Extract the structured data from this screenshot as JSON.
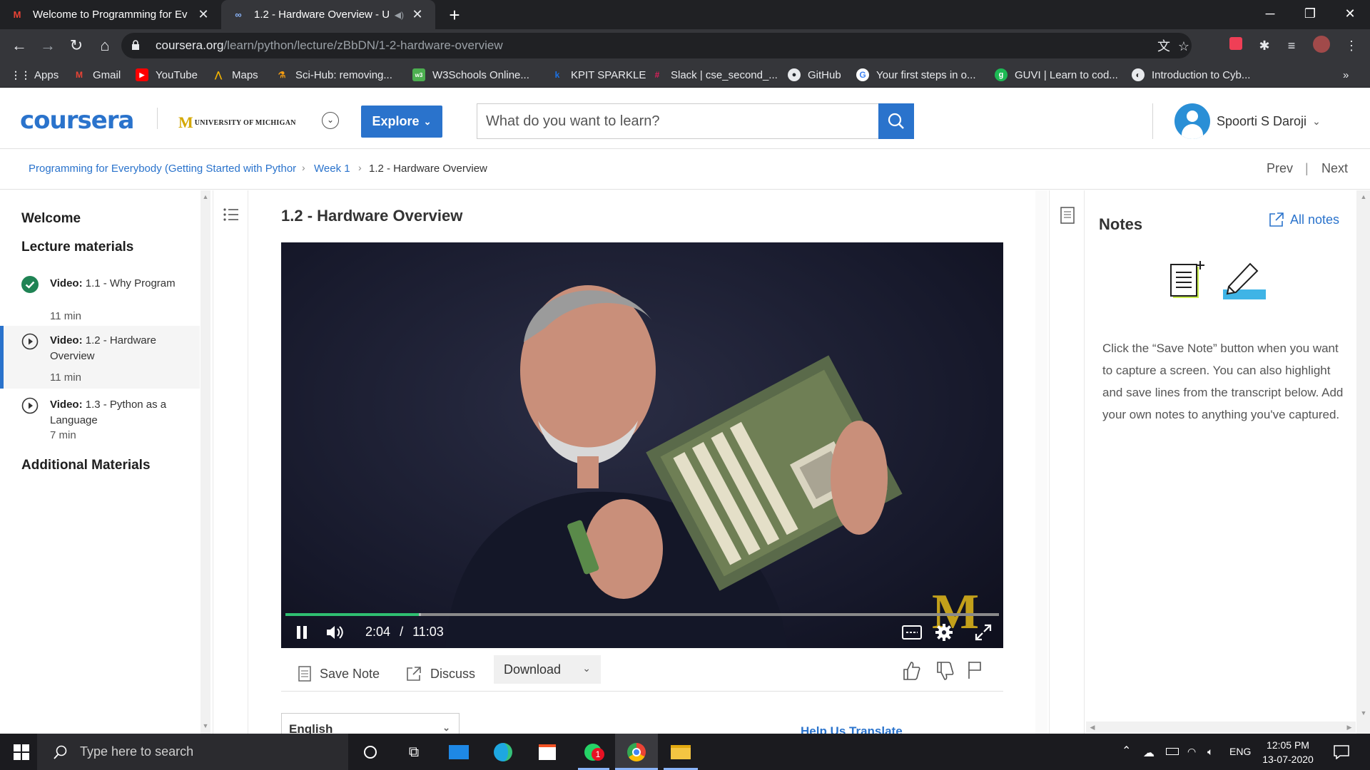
{
  "browser": {
    "tabs": [
      {
        "title": "Welcome to Programming for Ev",
        "favicon": "gmail-icon"
      },
      {
        "title": "1.2 - Hardware Overview - U",
        "favicon": "coursera-icon"
      }
    ],
    "url_domain": "coursera.org",
    "url_path": "/learn/python/lecture/zBbDN/1-2-hardware-overview",
    "bookmarks": [
      "Apps",
      "Gmail",
      "YouTube",
      "Maps",
      "Sci-Hub: removing...",
      "W3Schools Online...",
      "KPIT SPARKLE",
      "Slack | cse_second_...",
      "GitHub",
      "Your first steps in o...",
      "GUVI | Learn to cod...",
      "Introduction to Cyb..."
    ],
    "bookmarks_more": "»"
  },
  "header": {
    "logo": "coursera",
    "university_m": "M",
    "university": "UNIVERSITY OF MICHIGAN",
    "explore": "Explore",
    "search_placeholder": "What do you want to learn?",
    "user_name": "Spoorti S Daroji"
  },
  "breadcrumb": {
    "course": "Programming for Everybody (Getting Started with Pythor",
    "week": "Week 1",
    "current": "1.2 - Hardware Overview",
    "prev": "Prev",
    "separator": "|",
    "next": "Next"
  },
  "sidebar": {
    "welcome": "Welcome",
    "lecture_materials": "Lecture materials",
    "items": [
      {
        "kind": "Video:",
        "title": "1.1 - Why Program",
        "duration": "11 min",
        "status": "completed"
      },
      {
        "kind": "Video:",
        "title": "1.2 - Hardware Overview",
        "duration": "11 min",
        "status": "current"
      },
      {
        "kind": "Video:",
        "title": "1.3 - Python as a Language",
        "duration": "7 min",
        "status": "not-started"
      }
    ],
    "additional": "Additional Materials"
  },
  "lecture": {
    "title": "1.2 - Hardware Overview",
    "current_time": "2:04",
    "time_separator": "/",
    "duration": "11:03",
    "progress_fraction": 0.187,
    "buffered_fraction": 0.19,
    "watermark": "M"
  },
  "actions": {
    "save_note": "Save Note",
    "discuss": "Discuss",
    "download": "Download"
  },
  "transcript": {
    "language": "English",
    "help_translate": "Help Us Translate"
  },
  "notes": {
    "title": "Notes",
    "all_notes": "All notes",
    "description": "Click the “Save Note” button when you want to capture a screen. You can also highlight and save lines from the transcript below. Add your own notes to anything you've captured."
  },
  "taskbar": {
    "search_placeholder": "Type here to search",
    "language": "ENG",
    "time": "12:05 PM",
    "date": "13-07-2020",
    "whatsapp_badge": "1"
  },
  "colors": {
    "coursera_blue": "#2a73cc",
    "progress_green": "#2fbf71",
    "completed_green": "#1f8354"
  }
}
